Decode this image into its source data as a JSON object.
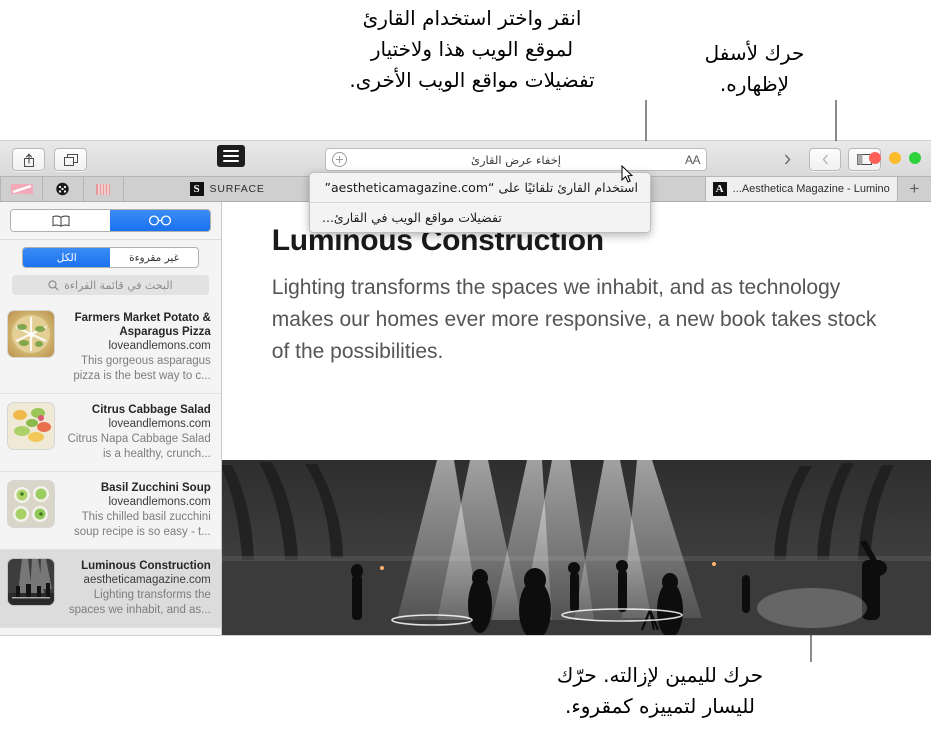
{
  "callouts": {
    "top_left": "انقر واختر استخدام القارئ\nلموقع الويب هذا ولاختيار\nتفضيلات مواقع الويب الأخرى.",
    "top_right": "حرك لأسفل\nلإظهاره.",
    "bottom_right": "حرك لليمين لإزالته. حرّك\nلليسار لتمييزه كمقروء."
  },
  "toolbar": {
    "tab_overview_icon": "tab-overview-icon",
    "share_icon": "share-icon",
    "text_size_label": "AA",
    "address_text": "إخفاء عرض القارئ",
    "add_icon": "plus-circle-icon",
    "reader_icon": "reader-lines-icon",
    "sidebar_toggle_icon": "sidebar-toggle-icon",
    "back_icon": "chevron-back-icon",
    "forward_icon": "chevron-forward-icon",
    "traffic_lights": [
      "#2dd33c",
      "#fcbc2c",
      "#fc6058"
    ]
  },
  "tabs": {
    "new_tab_label": "+",
    "items": [
      {
        "title": "Aesthetica Magazine - Lumino...",
        "favicon": "A",
        "active": true
      },
      {
        "title": "",
        "favicon": "",
        "active": false
      },
      {
        "title": "SURFACE",
        "favicon": "S",
        "active": false
      }
    ]
  },
  "reader_menu": {
    "items": [
      "استخدام القارئ تلقائيًا على “aestheticamagazine.com”",
      "تفضيلات مواقع الويب في القارئ..."
    ]
  },
  "article": {
    "title": "Luminous Construction",
    "lede": "Lighting transforms the spaces we inhabit, and as technology makes our homes ever more responsive, a new book takes stock of the possibilities."
  },
  "sidebar": {
    "segments": [
      {
        "name": "reading-list",
        "icon": "glasses-icon",
        "active": true
      },
      {
        "name": "bookmarks",
        "icon": "book-icon",
        "active": false
      }
    ],
    "filters": [
      {
        "label": "غير مقروءة",
        "active": false
      },
      {
        "label": "الكل",
        "active": true
      }
    ],
    "search_placeholder": "البحث في قائمة القراءة",
    "search_icon": "search-icon",
    "items": [
      {
        "title": "Farmers Market Potato & Asparagus Pizza",
        "site": "loveandlemons.com",
        "desc": "This gorgeous asparagus pizza is the best way to c...",
        "thumb": "pizza",
        "selected": false
      },
      {
        "title": "Citrus Cabbage Salad",
        "site": "loveandlemons.com",
        "desc": "Citrus Napa Cabbage Salad is a healthy, crunch...",
        "thumb": "salad",
        "selected": false
      },
      {
        "title": "Basil Zucchini Soup",
        "site": "loveandlemons.com",
        "desc": "This chilled basil zucchini soup recipe is so easy - t...",
        "thumb": "soup",
        "selected": false
      },
      {
        "title": "Luminous Construction",
        "site": "aestheticamagazine.com",
        "desc": "Lighting transforms the spaces we inhabit, and as...",
        "thumb": "gallery",
        "selected": true
      }
    ]
  }
}
